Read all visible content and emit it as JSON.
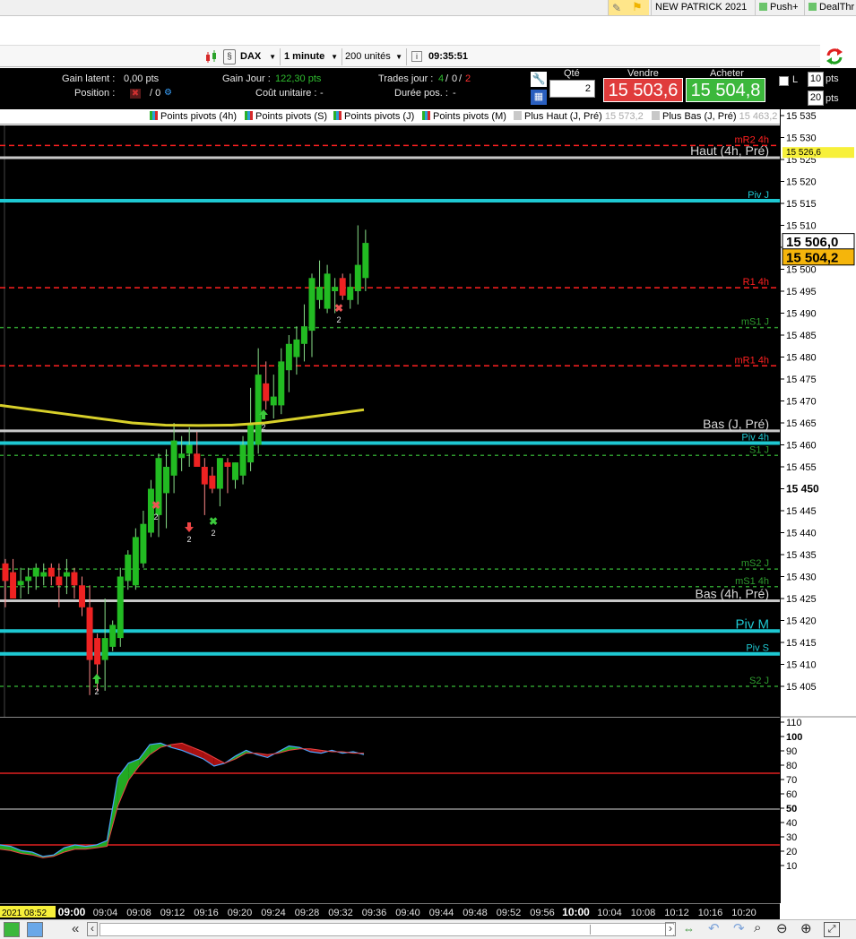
{
  "top_tabs": [
    {
      "label": "NEW PATRICK 2021"
    },
    {
      "label": "Push+"
    },
    {
      "label": "DealThr"
    }
  ],
  "toolbar": {
    "instrument": "DAX",
    "timeframe": "1 minute",
    "units": "200 unités",
    "info_glyph": "i",
    "clock": "09:35:51"
  },
  "info": {
    "gain_latent_label": "Gain latent :",
    "gain_latent_value": "0,00 pts",
    "position_label": "Position :",
    "position_value": "/ 0",
    "gain_jour_label": "Gain Jour :",
    "gain_jour_value": "122,30 pts",
    "cout_label": "Coût unitaire :",
    "cout_value": "-",
    "trades_label": "Trades jour :",
    "trades_a": "4",
    "trades_sep1": "/",
    "trades_b": "0",
    "trades_sep2": "/",
    "trades_c": "2",
    "duree_label": "Durée pos. :",
    "duree_value": "-"
  },
  "order": {
    "qty_label": "Qté",
    "qty_value": "2",
    "sell_label": "Vendre",
    "sell_price": "15 503,6",
    "buy_label": "Acheter",
    "buy_price": "15 504,8",
    "l_label": "L",
    "pts1_value": "10",
    "pts2_value": "20",
    "pts_label": "pts"
  },
  "legend": [
    {
      "label": "Points pivots (4h)",
      "kind": "pivot"
    },
    {
      "label": "Points pivots (S)",
      "kind": "pivot"
    },
    {
      "label": "Points pivots (J)",
      "kind": "pivot"
    },
    {
      "label": "Points pivots (M)",
      "kind": "pivot"
    },
    {
      "label": "Plus Haut (J, Pré)",
      "value": "15 573,2",
      "kind": "gray"
    },
    {
      "label": "Plus Bas (J, Pré)",
      "value": "15 463,2",
      "kind": "gray"
    }
  ],
  "price_axis": {
    "ticks": [
      "15 535",
      "15 530",
      "15 525",
      "15 520",
      "15 515",
      "15 510",
      "15 505",
      "15 500",
      "15 495",
      "15 490",
      "15 485",
      "15 480",
      "15 475",
      "15 470",
      "15 465",
      "15 460",
      "15 455",
      "15 450",
      "15 445",
      "15 440",
      "15 435",
      "15 430",
      "15 425",
      "15 420",
      "15 415",
      "15 410",
      "15 405"
    ],
    "bold_ticks": [
      "15 450"
    ],
    "last_price": "15 506,0",
    "bid_price": "15 504,2",
    "haut_tag": "15 526,6"
  },
  "levels": [
    {
      "label": "mR2 4h",
      "price": 15528.2,
      "color": "#ff2020",
      "style": "dash"
    },
    {
      "label": "Haut (4h, Pré)",
      "price": 15525.4,
      "color": "#c8c8c8",
      "style": "solid"
    },
    {
      "label": "Piv J",
      "price": 15515.6,
      "color": "#1ec8d2",
      "style": "solid"
    },
    {
      "label": "R1 4h",
      "price": 15495.8,
      "color": "#ff2020",
      "style": "dash"
    },
    {
      "label": "mS1 J",
      "price": 15486.7,
      "color": "#2e9a2e",
      "style": "dash"
    },
    {
      "label": "mR1 4h",
      "price": 15478.0,
      "color": "#ff2020",
      "style": "dash"
    },
    {
      "label": "Bas (J, Pré)",
      "price": 15463.2,
      "color": "#c8c8c8",
      "style": "solid"
    },
    {
      "label": "Piv 4h",
      "price": 15460.4,
      "color": "#1ec8d2",
      "style": "solid"
    },
    {
      "label": "S1 J",
      "price": 15457.6,
      "color": "#2e9a2e",
      "style": "dash"
    },
    {
      "label": "mS2 J",
      "price": 15431.7,
      "color": "#2e9a2e",
      "style": "dash"
    },
    {
      "label": "mS1 4h",
      "price": 15427.7,
      "color": "#2e9a2e",
      "style": "dash"
    },
    {
      "label": "Bas (4h, Pré)",
      "price": 15424.5,
      "color": "#c8c8c8",
      "style": "solid"
    },
    {
      "label": "Piv M",
      "price": 15417.6,
      "color": "#1ec8d2",
      "style": "solid"
    },
    {
      "label": "Piv S",
      "price": 15412.4,
      "color": "#1ec8d2",
      "style": "solid"
    },
    {
      "label": "S2 J",
      "price": 15405.0,
      "color": "#2e9a2e",
      "style": "dash"
    }
  ],
  "chart_data": {
    "type": "candlestick",
    "instrument": "DAX",
    "timeframe": "1 minute",
    "ylim": [
      15402,
      15536
    ],
    "candles": [
      {
        "o": 15433,
        "h": 15434,
        "l": 15423,
        "c": 15429
      },
      {
        "o": 15431,
        "h": 15434,
        "l": 15427,
        "c": 15425
      },
      {
        "o": 15428,
        "h": 15432,
        "l": 15425,
        "c": 15429
      },
      {
        "o": 15429,
        "h": 15432,
        "l": 15426,
        "c": 15430
      },
      {
        "o": 15430,
        "h": 15433,
        "l": 15427,
        "c": 15432
      },
      {
        "o": 15430,
        "h": 15433,
        "l": 15428,
        "c": 15431
      },
      {
        "o": 15432,
        "h": 15433,
        "l": 15428,
        "c": 15430
      },
      {
        "o": 15430,
        "h": 15433,
        "l": 15423,
        "c": 15428
      },
      {
        "o": 15430,
        "h": 15434,
        "l": 15426,
        "c": 15431
      },
      {
        "o": 15431,
        "h": 15432,
        "l": 15425,
        "c": 15428
      },
      {
        "o": 15428,
        "h": 15430,
        "l": 15421,
        "c": 15423
      },
      {
        "o": 15423,
        "h": 15428,
        "l": 15403,
        "c": 15411
      },
      {
        "o": 15416,
        "h": 15417,
        "l": 15404,
        "c": 15410
      },
      {
        "o": 15411,
        "h": 15425,
        "l": 15404,
        "c": 15416
      },
      {
        "o": 15414,
        "h": 15420,
        "l": 15413,
        "c": 15419
      },
      {
        "o": 15416,
        "h": 15432,
        "l": 15414,
        "c": 15430
      },
      {
        "o": 15429,
        "h": 15436,
        "l": 15427,
        "c": 15435
      },
      {
        "o": 15428,
        "h": 15441,
        "l": 15427,
        "c": 15439
      },
      {
        "o": 15433,
        "h": 15445,
        "l": 15432,
        "c": 15442
      },
      {
        "o": 15440,
        "h": 15452,
        "l": 15439,
        "c": 15450
      },
      {
        "o": 15444,
        "h": 15458,
        "l": 15439,
        "c": 15457
      },
      {
        "o": 15449,
        "h": 15459,
        "l": 15441,
        "c": 15455
      },
      {
        "o": 15453,
        "h": 15465,
        "l": 15449,
        "c": 15461
      },
      {
        "o": 15457,
        "h": 15462,
        "l": 15454,
        "c": 15458
      },
      {
        "o": 15458,
        "h": 15464,
        "l": 15455,
        "c": 15460
      },
      {
        "o": 15458,
        "h": 15463,
        "l": 15455,
        "c": 15455
      },
      {
        "o": 15455,
        "h": 15457,
        "l": 15444,
        "c": 15451
      },
      {
        "o": 15453,
        "h": 15455,
        "l": 15449,
        "c": 15450
      },
      {
        "o": 15450,
        "h": 15457,
        "l": 15446,
        "c": 15457
      },
      {
        "o": 15456,
        "h": 15457,
        "l": 15449,
        "c": 15455
      },
      {
        "o": 15452,
        "h": 15456,
        "l": 15450,
        "c": 15456
      },
      {
        "o": 15453,
        "h": 15462,
        "l": 15451,
        "c": 15460
      },
      {
        "o": 15456,
        "h": 15473,
        "l": 15454,
        "c": 15465
      },
      {
        "o": 15460,
        "h": 15482,
        "l": 15458,
        "c": 15476
      },
      {
        "o": 15474,
        "h": 15479,
        "l": 15468,
        "c": 15470
      },
      {
        "o": 15469,
        "h": 15476,
        "l": 15466,
        "c": 15471
      },
      {
        "o": 15469,
        "h": 15482,
        "l": 15467,
        "c": 15479
      },
      {
        "o": 15477,
        "h": 15485,
        "l": 15472,
        "c": 15483
      },
      {
        "o": 15480,
        "h": 15487,
        "l": 15476,
        "c": 15484
      },
      {
        "o": 15483,
        "h": 15492,
        "l": 15479,
        "c": 15487
      },
      {
        "o": 15486,
        "h": 15499,
        "l": 15480,
        "c": 15498
      },
      {
        "o": 15493,
        "h": 15502,
        "l": 15491,
        "c": 15496
      },
      {
        "o": 15491,
        "h": 15501,
        "l": 15490,
        "c": 15499
      },
      {
        "o": 15495,
        "h": 15498,
        "l": 15490,
        "c": 15496
      },
      {
        "o": 15498,
        "h": 15499,
        "l": 15493,
        "c": 15494
      },
      {
        "o": 15493,
        "h": 15499,
        "l": 15491,
        "c": 15496
      },
      {
        "o": 15495,
        "h": 15510,
        "l": 15492,
        "c": 15501
      },
      {
        "o": 15498,
        "h": 15509,
        "l": 15495,
        "c": 15506
      }
    ],
    "moving_average": [
      15469,
      15468,
      15467,
      15466,
      15465,
      15464.5,
      15464.4,
      15464.5,
      15465,
      15466,
      15467,
      15468
    ],
    "oscillator": {
      "ylim": [
        0,
        110
      ],
      "ticks": [
        "110",
        "100",
        "90",
        "80",
        "70",
        "60",
        "50",
        "40",
        "30",
        "20",
        "10"
      ],
      "bold_ticks": [
        "100",
        "50"
      ],
      "levels": [
        75,
        50,
        25
      ],
      "fast": [
        25,
        24,
        21,
        20,
        17,
        18,
        23,
        25,
        24,
        25,
        28,
        72,
        82,
        85,
        95,
        96,
        93,
        91,
        88,
        85,
        80,
        82,
        87,
        91,
        88,
        86,
        90,
        94,
        93,
        90,
        89,
        91,
        89,
        90,
        88
      ],
      "slow": [
        22,
        21,
        19,
        18,
        16,
        17,
        20,
        22,
        22,
        23,
        24,
        52,
        70,
        80,
        88,
        93,
        95,
        96,
        93,
        90,
        86,
        82,
        85,
        89,
        89,
        88,
        89,
        91,
        92,
        92,
        91,
        90,
        90,
        89,
        89
      ]
    },
    "time_ticks": [
      "09:00",
      "09:04",
      "09:08",
      "09:12",
      "09:16",
      "09:20",
      "09:24",
      "09:28",
      "09:32",
      "09:36",
      "09:40",
      "09:44",
      "09:48",
      "09:52",
      "09:56",
      "10:00",
      "10:04",
      "10:08",
      "10:12",
      "10:16",
      "10:20"
    ],
    "date_tag": "2021 08:52",
    "markers": [
      {
        "type": "buy",
        "label": "2"
      },
      {
        "type": "buy",
        "label": "2"
      },
      {
        "type": "exit",
        "label": "2"
      },
      {
        "type": "exit",
        "label": "2"
      },
      {
        "type": "sell",
        "label": "2"
      },
      {
        "type": "exit",
        "label": "2"
      }
    ]
  },
  "bottom": {
    "nav_left": "«",
    "nav_prev": "‹",
    "nav_next": "›"
  }
}
